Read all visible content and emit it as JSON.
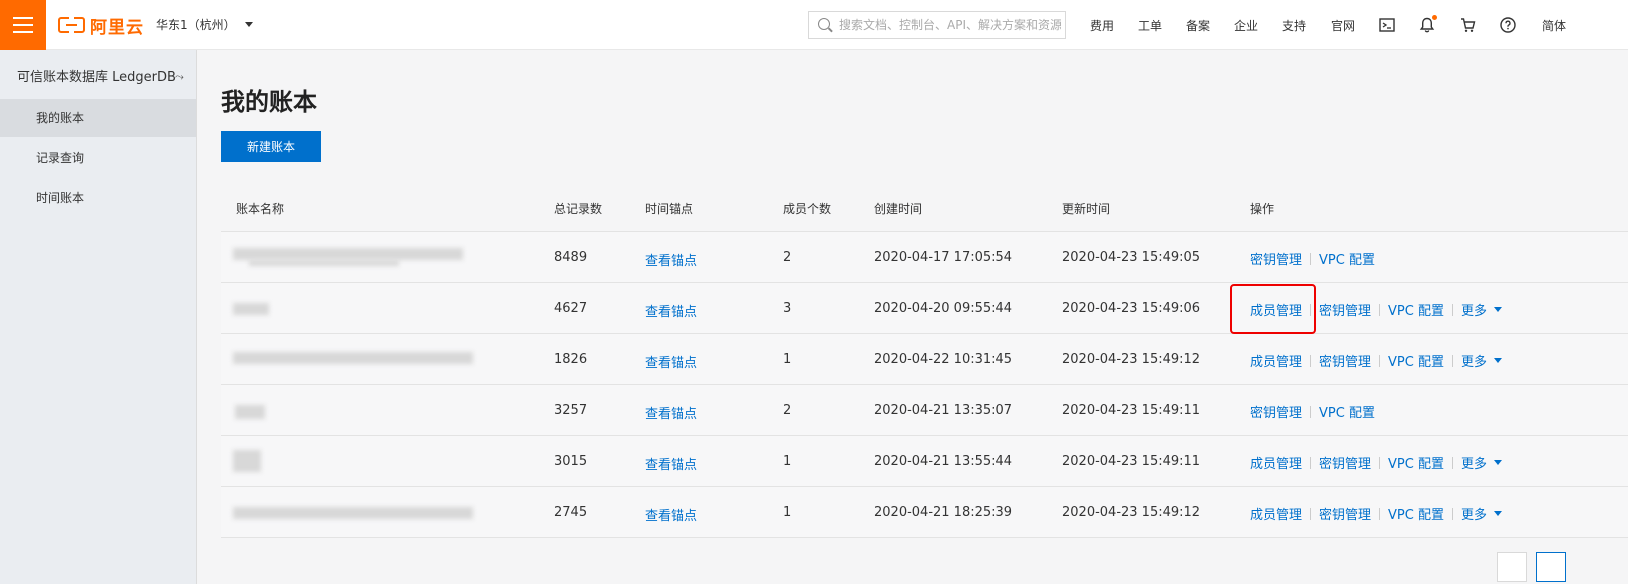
{
  "header": {
    "brand": "阿里云",
    "region": "华东1（杭州）",
    "search_placeholder": "搜索文档、控制台、API、解决方案和资源",
    "nav": [
      "费用",
      "工单",
      "备案",
      "企业",
      "支持",
      "官网"
    ],
    "lang": "简体",
    "icons": [
      "terminal-icon",
      "bell-icon",
      "cart-icon",
      "help-icon"
    ],
    "accent_color": "#ff6a00"
  },
  "sidebar": {
    "title": "可信账本数据库 LedgerDB",
    "toggle": "⤳",
    "items": [
      {
        "label": "我的账本",
        "active": true
      },
      {
        "label": "记录查询",
        "active": false
      },
      {
        "label": "时间账本",
        "active": false
      }
    ]
  },
  "main": {
    "title": "我的账本",
    "create_button": "新建账本",
    "table": {
      "columns": [
        "账本名称",
        "总记录数",
        "时间锚点",
        "成员个数",
        "创建时间",
        "更新时间",
        "操作"
      ],
      "rows": [
        {
          "records": "8489",
          "anchor": "查看锚点",
          "members": "2",
          "created": "2020-04-17 17:05:54",
          "updated": "2020-04-23 15:49:05",
          "ops": [
            "密钥管理",
            "VPC 配置"
          ],
          "more": ""
        },
        {
          "records": "4627",
          "anchor": "查看锚点",
          "members": "3",
          "created": "2020-04-20 09:55:44",
          "updated": "2020-04-23 15:49:06",
          "ops": [
            "成员管理",
            "密钥管理",
            "VPC 配置"
          ],
          "more": "更多"
        },
        {
          "records": "1826",
          "anchor": "查看锚点",
          "members": "1",
          "created": "2020-04-22 10:31:45",
          "updated": "2020-04-23 15:49:12",
          "ops": [
            "成员管理",
            "密钥管理",
            "VPC 配置"
          ],
          "more": "更多"
        },
        {
          "records": "3257",
          "anchor": "查看锚点",
          "members": "2",
          "created": "2020-04-21 13:35:07",
          "updated": "2020-04-23 15:49:11",
          "ops": [
            "密钥管理",
            "VPC 配置"
          ],
          "more": ""
        },
        {
          "records": "3015",
          "anchor": "查看锚点",
          "members": "1",
          "created": "2020-04-21 13:55:44",
          "updated": "2020-04-23 15:49:11",
          "ops": [
            "成员管理",
            "密钥管理",
            "VPC 配置"
          ],
          "more": "更多"
        },
        {
          "records": "2745",
          "anchor": "查看锚点",
          "members": "1",
          "created": "2020-04-21 18:25:39",
          "updated": "2020-04-23 15:49:12",
          "ops": [
            "成员管理",
            "密钥管理",
            "VPC 配置"
          ],
          "more": "更多"
        }
      ]
    },
    "link_color": "#0070cc",
    "highlight_color": "#e00000"
  }
}
